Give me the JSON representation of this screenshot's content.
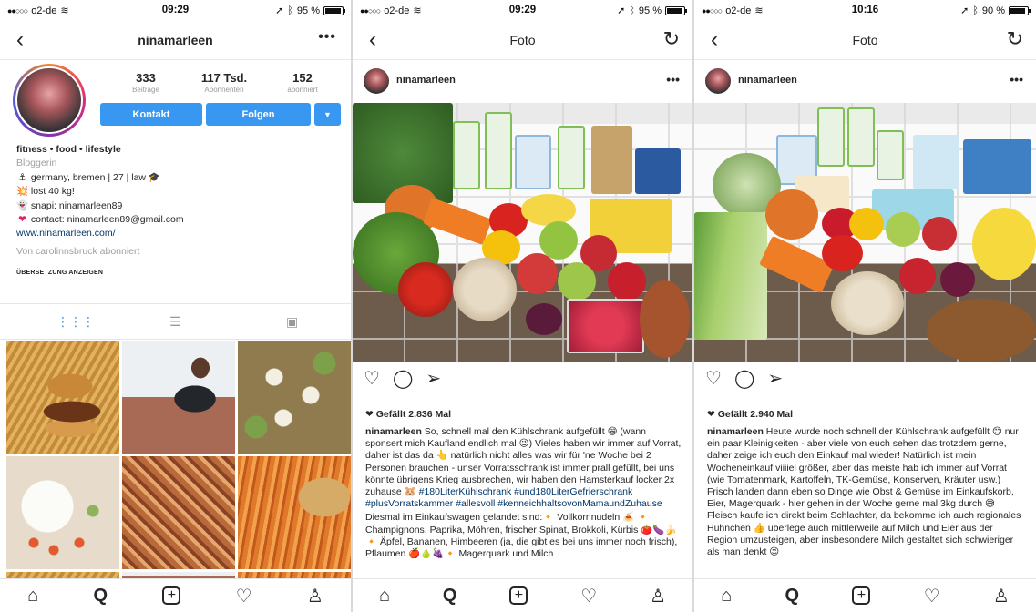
{
  "status": [
    {
      "carrier": "o2-de",
      "dots": "●●○○○",
      "time": "09:29",
      "battery": "95 %",
      "battery_level": 0.95
    },
    {
      "carrier": "o2-de",
      "dots": "●●○○○",
      "time": "09:29",
      "battery": "95 %",
      "battery_level": 0.95
    },
    {
      "carrier": "o2-de",
      "dots": "●●○○○",
      "time": "10:16",
      "battery": "90 %",
      "battery_level": 0.9
    }
  ],
  "profile": {
    "username": "ninamarleen",
    "stats": [
      {
        "num": "333",
        "label": "Beiträge"
      },
      {
        "num": "117 Tsd.",
        "label": "Abonnenten"
      },
      {
        "num": "152",
        "label": "abonniert"
      }
    ],
    "kontakt_label": "Kontakt",
    "folgen_label": "Folgen",
    "bio": {
      "name": "fitness • food • lifestyle",
      "category": "Bloggerin",
      "lines": [
        "germany, bremen | 27 | law",
        "lost 40 kg!",
        "snapi: ninamarleen89",
        "contact: ninamarleen89@gmail.com"
      ],
      "link": "www.ninamarleen.com/",
      "followed_by": "Von carolinnsbruck abonniert",
      "translate": "ÜBERSETZUNG ANZEIGEN"
    }
  },
  "post1": {
    "title": "Foto",
    "username": "ninamarleen",
    "likes": "Gefällt 2.836 Mal",
    "caption_user": "ninamarleen",
    "caption_text": "So, schnell mal den Kühlschrank aufgefüllt 😁 (wann sponsert mich Kaufland endlich mal 😉) Vieles haben wir immer auf Vorrat, daher ist das da 👆 natürlich nicht alles was wir für 'ne Woche bei 2 Personen brauchen - unser Vorratsschrank ist immer prall gefüllt, bei uns könnte übrigens Krieg ausbrechen, wir haben den Hamsterkauf locker 2x zuhause 🐹",
    "hashtags": "#180LiterKühlschrank #und180LiterGefrierschrank #plusVorratskammer #allesvoll #kenneichhaltsovonMamaundZuhause",
    "caption_more": "Diesmal im Einkaufswagen gelandet sind:🔸 Vollkornnudeln 🍝 🔸 Champignons, Paprika, Möhren, frischer Spinat, Brokkoli, Kürbis 🍅🍆🍌🔸 Äpfel, Bananen, Himbeeren (ja, die gibt es bei uns immer noch frisch), Pflaumen 🍎🍐🍇🔸 Magerquark und Milch"
  },
  "post2": {
    "title": "Foto",
    "username": "ninamarleen",
    "likes": "Gefällt 2.940 Mal",
    "caption_user": "ninamarleen",
    "caption_text": "Heute wurde noch schnell der Kühlschrank aufgefüllt 😊 nur ein paar Kleinigkeiten - aber viele von euch sehen das trotzdem gerne, daher zeige ich euch den Einkauf mal wieder! Natürlich ist mein Wocheneinkauf viiiiel größer, aber das meiste hab ich immer auf Vorrat (wie Tomatenmark, Kartoffeln, TK-Gemüse, Konserven, Kräuter usw.) Frisch landen dann eben so Dinge wie Obst & Gemüse im Einkaufskorb, Eier, Magerquark - hier gehen in der Woche gerne mal 3kg durch 😅 Fleisch kaufe ich direkt beim Schlachter, da bekomme ich auch regionales Hühnchen 👍 überlege auch mittlerweile auf Milch und Eier aus der Region umzusteigen, aber insbesondere Milch gestaltet sich schwieriger als man denkt 😉"
  },
  "icons": {
    "back": "‹",
    "more": "•••",
    "reload": "↻",
    "heart": "♡",
    "comment": "◯",
    "share": "➢",
    "home": "⌂",
    "search": "⚲",
    "add": "+",
    "activity": "♡",
    "profile": "👤"
  },
  "colors": {
    "accent": "#3897f0",
    "link": "#003569",
    "muted": "#999999"
  }
}
